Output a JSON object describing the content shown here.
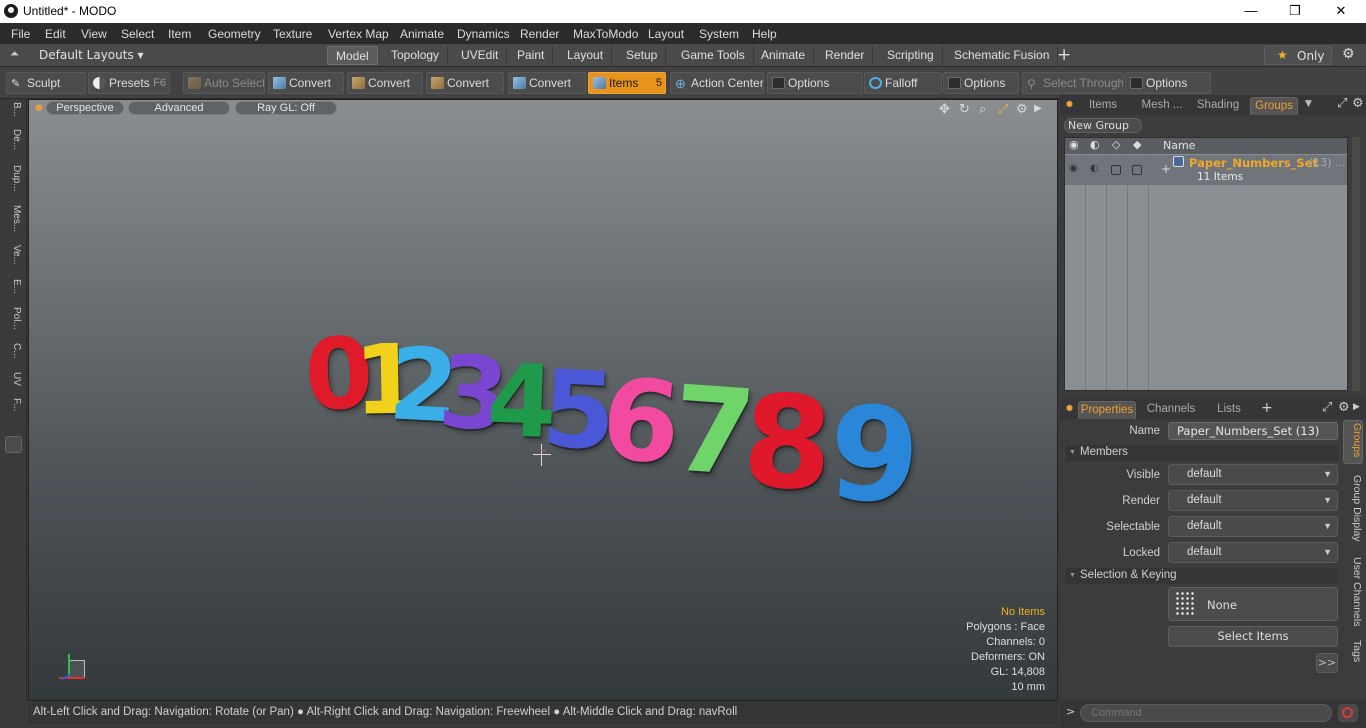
{
  "window": {
    "title": "Untitled* - MODO",
    "controls": [
      "—",
      "❐",
      "✕"
    ]
  },
  "menu": [
    "File",
    "Edit",
    "View",
    "Select",
    "Item",
    "Geometry",
    "Texture",
    "Vertex Map",
    "Animate",
    "Dynamics",
    "Render",
    "MaxToModo",
    "Layout",
    "System",
    "Help"
  ],
  "layouts": {
    "label": "Default Layouts ▾",
    "tabs": [
      "Model",
      "Topology",
      "UVEdit",
      "Paint",
      "Layout",
      "Setup",
      "Game Tools",
      "Animate",
      "Render",
      "Scripting",
      "Schematic Fusion"
    ],
    "active": "Model",
    "only_label": "Only"
  },
  "toolbar": {
    "sculpt": "Sculpt",
    "presets": "Presets",
    "presets_key": "F6",
    "auto_select": "Auto Select",
    "convert1": "Convert",
    "convert2": "Convert",
    "convert3": "Convert",
    "convert4": "Convert",
    "items": "Items",
    "items_key": "5",
    "action_center": "Action Center",
    "options1": "Options",
    "falloff": "Falloff",
    "options2": "Options",
    "select_through": "Select Through",
    "options3": "Options"
  },
  "left_tabs": [
    "B...",
    "De...",
    "Dup...",
    "Mes...",
    "Ve...",
    "E...",
    "Pol...",
    "C...",
    "UV",
    "F..."
  ],
  "viewport": {
    "perspective": "Perspective",
    "advanced": "Advanced",
    "raygl": "Ray GL: Off",
    "digits": [
      {
        "char": "0",
        "color": "#e01a2a"
      },
      {
        "char": "1",
        "color": "#f2d11a"
      },
      {
        "char": "2",
        "color": "#3aaee6"
      },
      {
        "char": "3",
        "color": "#7a45d0"
      },
      {
        "char": "4",
        "color": "#1f9a4a"
      },
      {
        "char": "5",
        "color": "#4a58d8"
      },
      {
        "char": "6",
        "color": "#f24aa0"
      },
      {
        "char": "7",
        "color": "#6fd56a"
      },
      {
        "char": "8",
        "color": "#e0182c"
      },
      {
        "char": "9",
        "color": "#2a86d8"
      }
    ],
    "stats": {
      "no_items": "No Items",
      "polygons": "Polygons : Face",
      "channels": "Channels: 0",
      "deformers": "Deformers: ON",
      "gl": "GL: 14,808",
      "units": "10 mm"
    }
  },
  "statusbar": "Alt-Left Click and Drag: Navigation: Rotate (or Pan) ● Alt-Right Click and Drag: Navigation: Freewheel ● Alt-Middle Click and Drag: navRoll",
  "right_panel": {
    "tabs": [
      "Items",
      "Mesh ...",
      "Shading",
      "Groups"
    ],
    "active_tab": "Groups",
    "new_group": "New Group",
    "col_name": "Name",
    "group_name": "Paper_Numbers_Set",
    "group_count": "(13) ...",
    "group_items": "11 Items",
    "prop_tabs": [
      "Properties",
      "Channels",
      "Lists"
    ],
    "name_label": "Name",
    "name_value": "Paper_Numbers_Set (13)",
    "members": "Members",
    "visible_label": "Visible",
    "visible_value": "default",
    "render_label": "Render",
    "render_value": "default",
    "selectable_label": "Selectable",
    "selectable_value": "default",
    "locked_label": "Locked",
    "locked_value": "default",
    "sel_keying": "Selection & Keying",
    "none": "None",
    "select_items": "Select Items",
    "more": ">>",
    "side_tabs": [
      "Groups",
      "Group Display",
      "User Channels",
      "Tags"
    ],
    "command_placeholder": "Command"
  }
}
